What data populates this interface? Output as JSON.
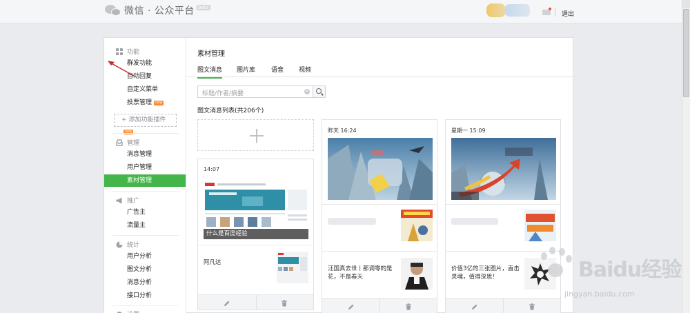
{
  "header": {
    "logo_text": "微信 · 公众平台",
    "beta": "beta",
    "logout": "退出"
  },
  "sidebar": {
    "sections": [
      {
        "title": "功能",
        "icon": "grid-icon",
        "items": [
          {
            "label": "群发功能"
          },
          {
            "label": "自动回复"
          },
          {
            "label": "自定义菜单"
          },
          {
            "label": "投票管理",
            "badge": "new"
          }
        ]
      },
      {
        "title": "管理",
        "icon": "inbox-icon",
        "items": [
          {
            "label": "消息管理"
          },
          {
            "label": "用户管理"
          },
          {
            "label": "素材管理",
            "active": true
          }
        ]
      },
      {
        "title": "推广",
        "icon": "megaphone-icon",
        "items": [
          {
            "label": "广告主"
          },
          {
            "label": "流量主"
          }
        ]
      },
      {
        "title": "统计",
        "icon": "pie-chart-icon",
        "items": [
          {
            "label": "用户分析"
          },
          {
            "label": "图文分析"
          },
          {
            "label": "消息分析"
          },
          {
            "label": "接口分析"
          }
        ]
      },
      {
        "title": "设置",
        "icon": "settings-icon",
        "items": []
      }
    ],
    "add_plugin": "添加功能插件",
    "add_plugin_badge": "new"
  },
  "content": {
    "title": "素材管理",
    "tabs": [
      "图文消息",
      "图片库",
      "语音",
      "视频"
    ],
    "active_tab": 0,
    "search": {
      "placeholder": "标题/作者/摘要",
      "value": ""
    },
    "list_title": "图文消息列表(共206个)"
  },
  "cards": [
    {
      "date": "14:07",
      "cover_caption": "什么是百度经验",
      "sub_title": "阿凡达"
    },
    {
      "date": "昨天 16:24",
      "sub_title": "汪国真去世丨那调零的是花，不是春天"
    },
    {
      "date": "星期一 15:09",
      "sub_title": "价值3亿的三张图片，直击灵魂，值得深思！"
    }
  ],
  "watermark": {
    "brand": "Baidu经验",
    "url": "jingyan.baidu.com"
  },
  "colors": {
    "accent": "#44b549",
    "badge": "#f78c32",
    "arrow": "#c62b2b"
  }
}
